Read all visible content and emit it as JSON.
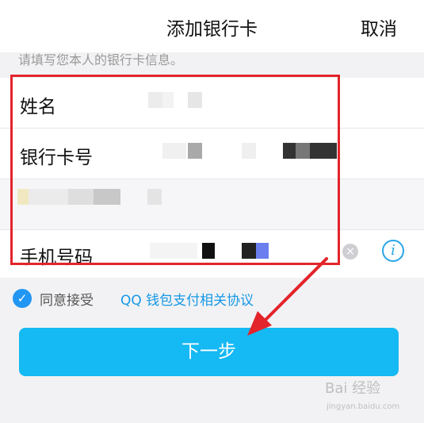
{
  "header": {
    "title": "添加银行卡",
    "cancel_label": "取消"
  },
  "hint": "请填写您本人的银行卡信息。",
  "form": {
    "name_label": "姓名",
    "card_label": "银行卡号",
    "phone_label": "手机号码"
  },
  "icons": {
    "clear": "clear-circle-icon",
    "info": "info-circle-icon",
    "check": "checkmark-icon"
  },
  "agreement": {
    "text": "同意接受",
    "link": "QQ 钱包支付相关协议"
  },
  "next_label": "下一步",
  "watermark": {
    "brand": "Bai 经验",
    "sub": "jingyan.baidu.com"
  },
  "colors": {
    "primary": "#15b9f3",
    "link": "#1598e6",
    "highlight": "#e3242b",
    "info": "#2aa6e8"
  }
}
